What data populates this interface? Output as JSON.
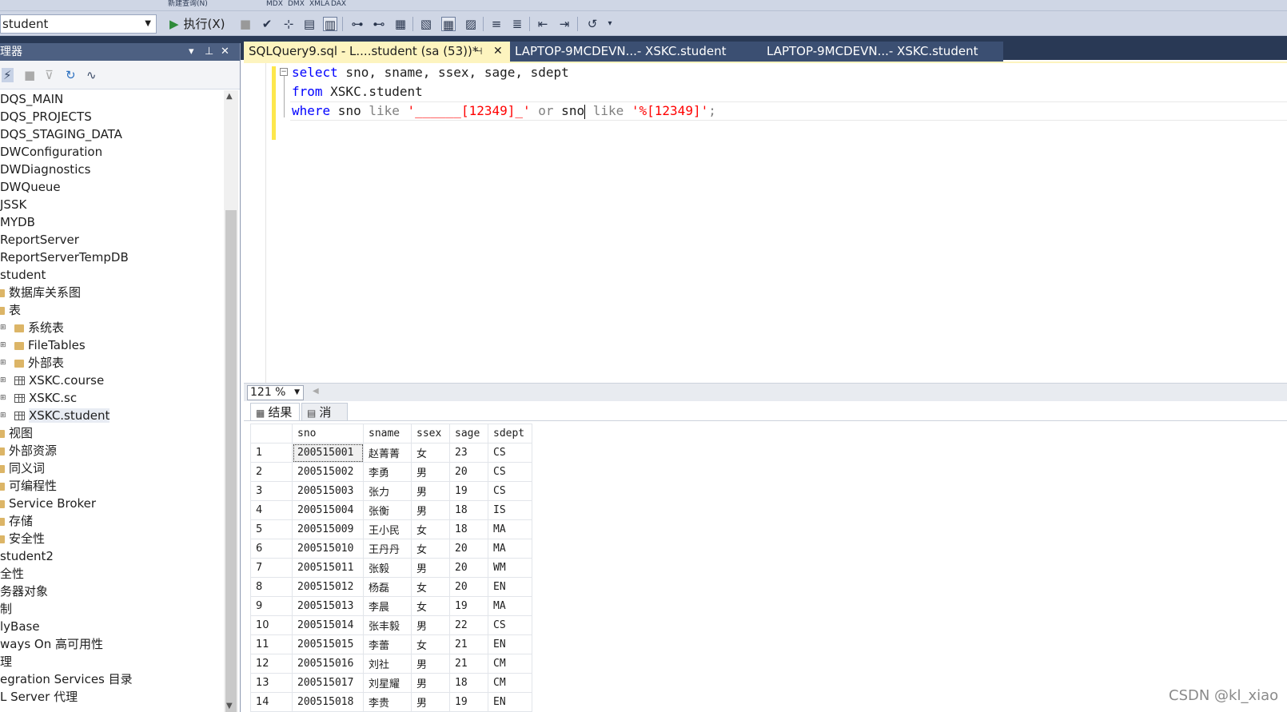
{
  "toolbar": {
    "database": "student",
    "new_query_label": "新建查询(N)",
    "small_labels": [
      "MDX",
      "DMX",
      "XMLA",
      "DAX"
    ],
    "execute_label": "执行(X)"
  },
  "object_explorer": {
    "title": "理器",
    "items": [
      {
        "label": "DQS_MAIN",
        "indent": 0,
        "icon": "none",
        "expand": ""
      },
      {
        "label": "DQS_PROJECTS",
        "indent": 0,
        "icon": "none",
        "expand": ""
      },
      {
        "label": "DQS_STAGING_DATA",
        "indent": 0,
        "icon": "none",
        "expand": ""
      },
      {
        "label": "DWConfiguration",
        "indent": 0,
        "icon": "none",
        "expand": ""
      },
      {
        "label": "DWDiagnostics",
        "indent": 0,
        "icon": "none",
        "expand": ""
      },
      {
        "label": "DWQueue",
        "indent": 0,
        "icon": "none",
        "expand": ""
      },
      {
        "label": "JSSK",
        "indent": 0,
        "icon": "none",
        "expand": ""
      },
      {
        "label": "MYDB",
        "indent": 0,
        "icon": "none",
        "expand": ""
      },
      {
        "label": "ReportServer",
        "indent": 0,
        "icon": "none",
        "expand": ""
      },
      {
        "label": "ReportServerTempDB",
        "indent": 0,
        "icon": "none",
        "expand": ""
      },
      {
        "label": "student",
        "indent": 0,
        "icon": "none",
        "expand": ""
      },
      {
        "label": "数据库关系图",
        "indent": 0,
        "icon": "folder",
        "expand": ""
      },
      {
        "label": "表",
        "indent": 0,
        "icon": "folder",
        "expand": ""
      },
      {
        "label": "系统表",
        "indent": 1,
        "icon": "folder",
        "expand": "⊞"
      },
      {
        "label": "FileTables",
        "indent": 1,
        "icon": "folder",
        "expand": "⊞"
      },
      {
        "label": "外部表",
        "indent": 1,
        "icon": "folder",
        "expand": "⊞"
      },
      {
        "label": "XSKC.course",
        "indent": 1,
        "icon": "table",
        "expand": "⊞"
      },
      {
        "label": "XSKC.sc",
        "indent": 1,
        "icon": "table",
        "expand": "⊞"
      },
      {
        "label": "XSKC.student",
        "indent": 1,
        "icon": "table",
        "expand": "⊞",
        "selected": true
      },
      {
        "label": "视图",
        "indent": 0,
        "icon": "folder",
        "expand": ""
      },
      {
        "label": "外部资源",
        "indent": 0,
        "icon": "folder",
        "expand": ""
      },
      {
        "label": "同义词",
        "indent": 0,
        "icon": "folder",
        "expand": ""
      },
      {
        "label": "可编程性",
        "indent": 0,
        "icon": "folder",
        "expand": ""
      },
      {
        "label": "Service Broker",
        "indent": 0,
        "icon": "folder",
        "expand": ""
      },
      {
        "label": "存储",
        "indent": 0,
        "icon": "folder",
        "expand": ""
      },
      {
        "label": "安全性",
        "indent": 0,
        "icon": "folder",
        "expand": ""
      },
      {
        "label": "student2",
        "indent": 0,
        "icon": "none",
        "expand": ""
      },
      {
        "label": "全性",
        "indent": 0,
        "icon": "none",
        "expand": ""
      },
      {
        "label": "务器对象",
        "indent": 0,
        "icon": "none",
        "expand": ""
      },
      {
        "label": "制",
        "indent": 0,
        "icon": "none",
        "expand": ""
      },
      {
        "label": "lyBase",
        "indent": 0,
        "icon": "none",
        "expand": ""
      },
      {
        "label": "ways On 高可用性",
        "indent": 0,
        "icon": "none",
        "expand": ""
      },
      {
        "label": "理",
        "indent": 0,
        "icon": "none",
        "expand": ""
      },
      {
        "label": "egration Services 目录",
        "indent": 0,
        "icon": "none",
        "expand": ""
      },
      {
        "label": "L Server 代理",
        "indent": 0,
        "icon": "none",
        "expand": ""
      }
    ]
  },
  "tabs": {
    "active": {
      "label": "SQLQuery9.sql - L....student (sa (53))*"
    },
    "others": [
      {
        "label": "LAPTOP-9MCDEVN...- XSKC.student"
      },
      {
        "label": "LAPTOP-9MCDEVN...- XSKC.student"
      }
    ]
  },
  "editor": {
    "line1": {
      "kw": "select",
      "rest": " sno, sname, ssex, sage, sdept"
    },
    "line2": {
      "kw": "from",
      "rest": " XSKC.student"
    },
    "line3": {
      "kw_where": "where",
      "col1": " sno ",
      "like1": "like",
      "pattern1": " '______[12349]_'",
      "or": " or",
      "col2": " sno",
      "like2": " like",
      "pattern2": " '%[12349]'",
      "end": ";"
    }
  },
  "zoom": {
    "value": "121 %"
  },
  "results": {
    "tab_results": "结果",
    "tab_messages": "消息",
    "columns": [
      "sno",
      "sname",
      "ssex",
      "sage",
      "sdept"
    ],
    "rows": [
      [
        "1",
        "200515001",
        "赵菁菁",
        "女",
        "23",
        "CS"
      ],
      [
        "2",
        "200515002",
        "李勇",
        "男",
        "20",
        "CS"
      ],
      [
        "3",
        "200515003",
        "张力",
        "男",
        "19",
        "CS"
      ],
      [
        "4",
        "200515004",
        "张衡",
        "男",
        "18",
        "IS"
      ],
      [
        "5",
        "200515009",
        "王小民",
        "女",
        "18",
        "MA"
      ],
      [
        "6",
        "200515010",
        "王丹丹",
        "女",
        "20",
        "MA"
      ],
      [
        "7",
        "200515011",
        "张毅",
        "男",
        "20",
        "WM"
      ],
      [
        "8",
        "200515012",
        "杨磊",
        "女",
        "20",
        "EN"
      ],
      [
        "9",
        "200515013",
        "李晨",
        "女",
        "19",
        "MA"
      ],
      [
        "10",
        "200515014",
        "张丰毅",
        "男",
        "22",
        "CS"
      ],
      [
        "11",
        "200515015",
        "李蕾",
        "女",
        "21",
        "EN"
      ],
      [
        "12",
        "200515016",
        "刘社",
        "男",
        "21",
        "CM"
      ],
      [
        "13",
        "200515017",
        "刘星耀",
        "男",
        "18",
        "CM"
      ],
      [
        "14",
        "200515018",
        "李贵",
        "男",
        "19",
        "EN"
      ]
    ]
  },
  "watermark": "CSDN @kl_xiao"
}
